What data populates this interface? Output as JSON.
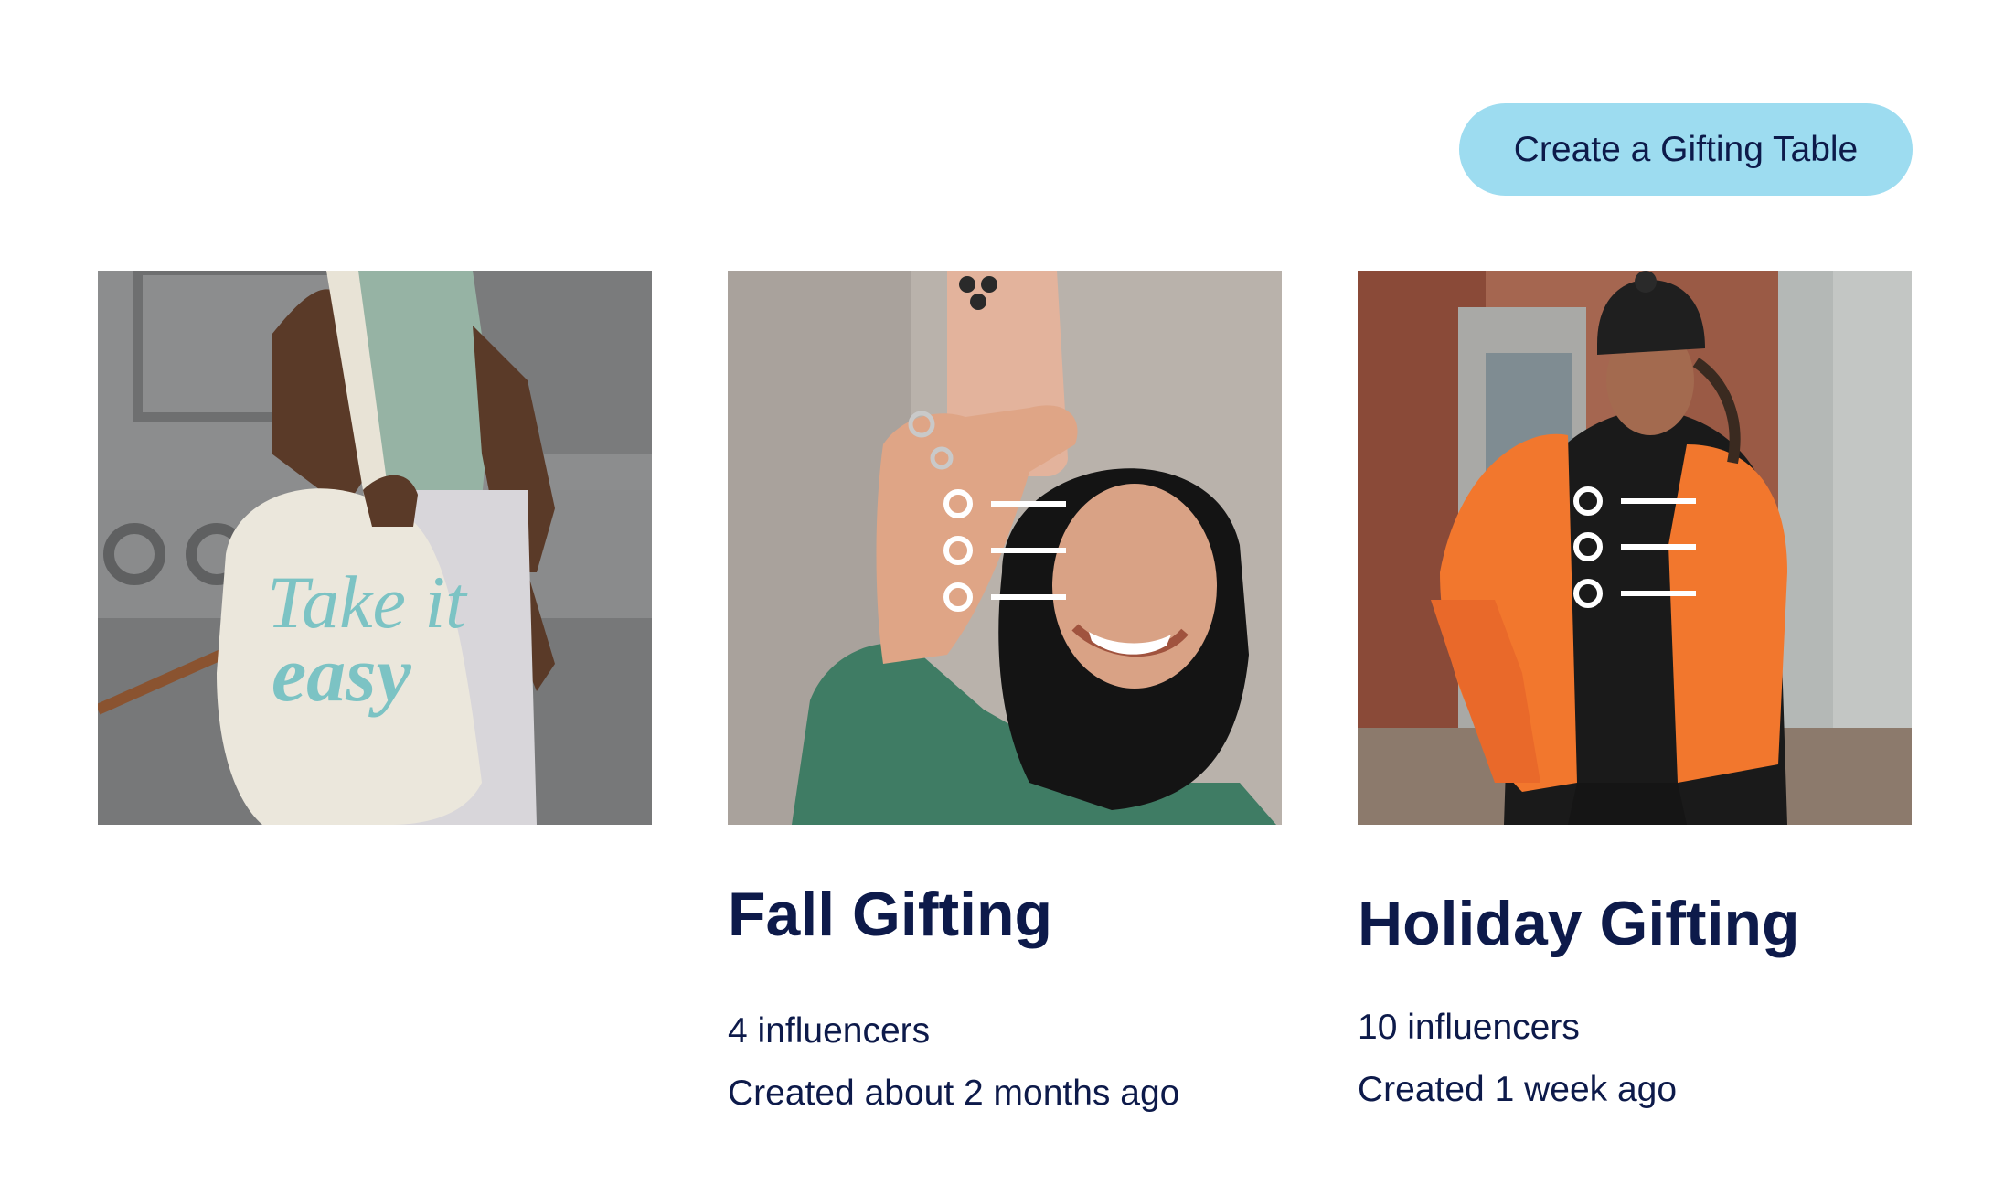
{
  "header": {
    "create_button_label": "Create a Gifting Table"
  },
  "cards": [
    {
      "image_text": [
        "Take it",
        "easy"
      ],
      "title": "",
      "influencers": "",
      "created": ""
    },
    {
      "title": "Fall Gifting",
      "influencers": "4 influencers",
      "created": "Created about 2 months ago"
    },
    {
      "title": "Holiday Gifting",
      "influencers": "10 influencers",
      "created": "Created 1 week ago"
    }
  ],
  "icons": {
    "list_overlay": "list-icon"
  },
  "colors": {
    "button_bg": "#9ddcf0",
    "text_primary": "#0d1a4a",
    "accent_orange": "#f26a2a",
    "tote_text": "#7cc3c4"
  }
}
